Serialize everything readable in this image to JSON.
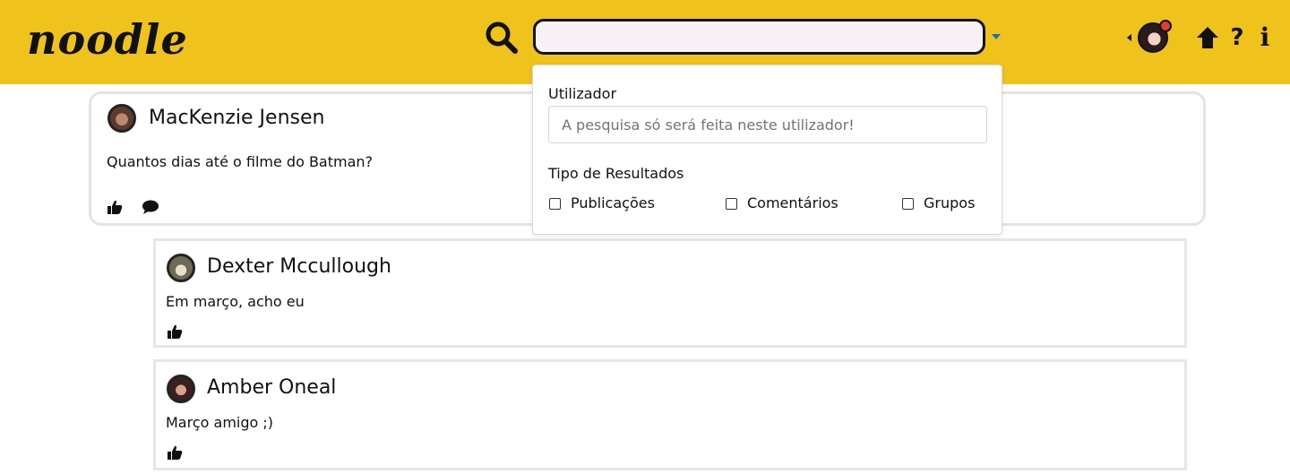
{
  "header": {
    "logo": "noodle",
    "search": {
      "value": "",
      "placeholder": ""
    }
  },
  "search_dropdown": {
    "user_label": "Utilizador",
    "user_placeholder": "A pesquisa só será feita neste utilizador!",
    "results_label": "Tipo de Resultados",
    "options": [
      {
        "label": "Publicações",
        "checked": false
      },
      {
        "label": "Comentários",
        "checked": false
      },
      {
        "label": "Grupos",
        "checked": false
      }
    ]
  },
  "post": {
    "author": "MacKenzie Jensen",
    "text": "Quantos dias até o filme do Batman?"
  },
  "comments": [
    {
      "author": "Dexter Mccullough",
      "text": "Em março, acho eu"
    },
    {
      "author": "Amber Oneal",
      "text": "Março amigo ;)"
    }
  ],
  "colors": {
    "header_bg": "#f0c21c",
    "notification": "#e53935",
    "caret": "#1b6ec2"
  },
  "icons": [
    "search-icon",
    "chevron-down-icon",
    "chevron-left-icon",
    "avatar",
    "arrow-up-icon",
    "help-icon",
    "info-icon",
    "thumbs-up-icon",
    "comment-icon"
  ]
}
